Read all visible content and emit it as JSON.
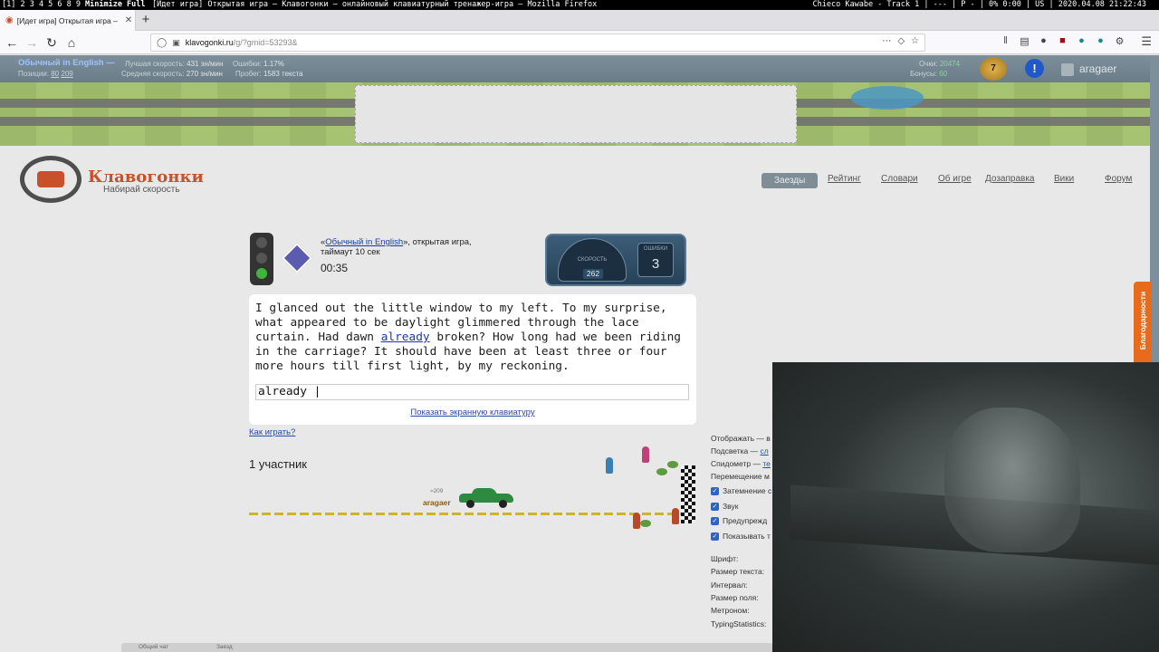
{
  "wm": {
    "workspaces": "[1] 2 3 4 5 6 8 9",
    "minimize": "Minimize Full",
    "window_title": "[Идет игра] Открытая игра – Клавогонки – онлайновый клавиатурный тренажер-игра – Mozilla Firefox",
    "status": "Chieco Kawabe - Track 1 | --- | P - | 0% 0:00 | US | 2020.04.08 21:22:43"
  },
  "browser": {
    "tab_title": "[Идет игра] Открытая игра – К",
    "url_domain": "klavogonki.ru",
    "url_path": "/g/?gmid=53293&"
  },
  "userbar": {
    "mode": "Обычный in English —",
    "position_label": "Позиции:",
    "position_value": "80",
    "position_total": "209",
    "best_speed_label": "Лучшая скорость:",
    "best_speed_value": "431 зн/мин",
    "avg_speed_label": "Средняя скорость:",
    "avg_speed_value": "270 зн/мин",
    "errors_label": "Ошибки:",
    "errors_value": "1.17%",
    "mileage_label": "Пробег:",
    "mileage_value": "1583 текста",
    "points_label": "Очки:",
    "points_value": "20474",
    "bonus_label": "Бонусы:",
    "bonus_value": "60",
    "level": "7",
    "alert": "!",
    "username": "aragaer"
  },
  "logo": {
    "title": "Клавогонки",
    "subtitle": "Набирай скорость"
  },
  "nav": [
    "Заезды",
    "Рейтинг",
    "Словари",
    "Об игре",
    "Дозаправка",
    "Вики",
    "Форум"
  ],
  "game": {
    "quote_open": "«",
    "mode_link": "Обычный in English",
    "info_rest": "», открытая игра, таймаут 10 сек",
    "timer": "00:35",
    "speed_label": "СКОРОСТЬ",
    "speed_value": "262",
    "errors_label": "ОШИБКИ",
    "errors_value": "3"
  },
  "typing": {
    "text_before": "I glanced out the little window to my left. To my surprise, what appeared to be daylight glimmered through the lace curtain. Had dawn ",
    "current_word": "already",
    "text_after": " broken? How long had we been riding in the carriage? It should have been at least three or four more hours till first light, by my reckoning.",
    "input_value": "already |",
    "keyboard_link": "Показать экранную клавиатуру"
  },
  "howto": "Как играть?",
  "participants": "1 участник",
  "racer": {
    "name": "aragaer",
    "speed": "≈209"
  },
  "settings": {
    "display": "Отображать — в",
    "highlight": "Подсветка — ",
    "highlight_link": "сл",
    "speedometer": "Спидометр — ",
    "speedometer_link": "те",
    "movement": "Перемещение м",
    "dim": "Затемнение с",
    "sound": "Звук",
    "warn": "Предупрежд",
    "show": "Показывать т",
    "font": "Шрифт:",
    "text_size": "Размер текста:",
    "interval": "Интервал:",
    "field_size": "Размер поля:",
    "metronome": "Метроном:",
    "typing_stats": "TypingStatistics:"
  },
  "thanks_tab": "Благодарности",
  "chat": {
    "general": "Общий чат",
    "race": "Заезд"
  },
  "colors": {
    "accent_link": "#2a4aa5",
    "brand_orange": "#c8502a",
    "userbar": "#7d8f9a",
    "car": "#2e8a41"
  }
}
